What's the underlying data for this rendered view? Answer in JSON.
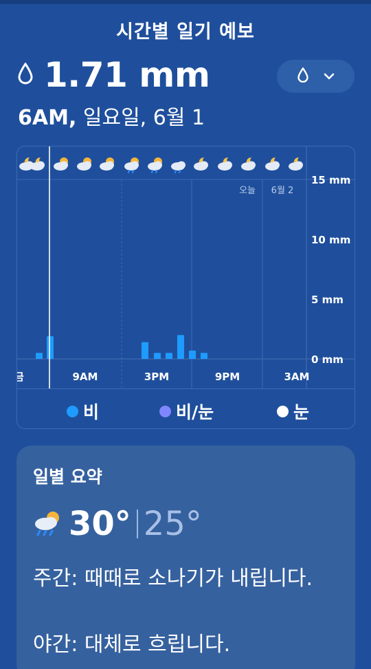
{
  "header": {
    "title": "시간별 일기 예보"
  },
  "current": {
    "precip_value": "1.71 mm",
    "time": "6AM,",
    "date": " 일요일, 6월 1"
  },
  "selector": {
    "icon": "water-drop-icon",
    "chevron": "chevron-down-icon"
  },
  "chart": {
    "y_ticks": [
      "15 mm",
      "10 mm",
      "5 mm",
      "0 mm"
    ],
    "x_ticks": [
      "금",
      "9AM",
      "3PM",
      "9PM",
      "3AM"
    ],
    "day_labels": [
      "오늘",
      "6월 2"
    ],
    "hour_icons": [
      "partly-cloudy-night",
      "partly-cloudy-night",
      "partly-cloudy",
      "partly-cloudy",
      "partly-cloudy",
      "rain-sun",
      "rain-sun",
      "rain",
      "partly-cloudy-night",
      "partly-cloudy-night",
      "partly-cloudy-night",
      "partly-cloudy-night",
      "partly-cloudy-night"
    ]
  },
  "chart_data": {
    "type": "bar",
    "ylabel": "",
    "ylim": [
      0,
      15
    ],
    "series": [
      {
        "values": [
          0.5,
          1.9,
          0,
          0,
          0,
          0,
          0,
          0,
          1.4,
          0.5,
          0.5,
          2.0,
          0.7,
          0.5
        ]
      }
    ],
    "current_index": 1
  },
  "legend": [
    {
      "label": "비",
      "color": "#1e9bff"
    },
    {
      "label": "비/눈",
      "color": "#7f86ff"
    },
    {
      "label": "눈",
      "color": "#ffffff"
    }
  ],
  "summary": {
    "title": "일별 요약",
    "icon": "rain-sun-icon",
    "high": "30°",
    "low": "25°",
    "day_text": "주간: 때때로 소나기가 내립니다.",
    "night_text": "야간: 대체로 흐립니다."
  }
}
